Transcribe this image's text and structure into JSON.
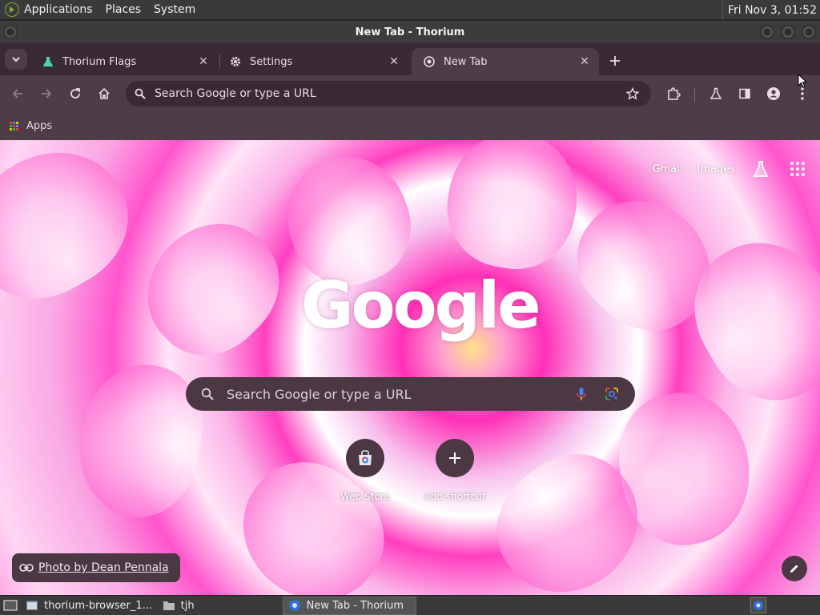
{
  "top_panel": {
    "menus": [
      "Applications",
      "Places",
      "System"
    ],
    "clock": "Fri Nov  3, 01:52"
  },
  "window": {
    "title": "New Tab - Thorium"
  },
  "tabs": [
    {
      "label": "Thorium Flags",
      "icon": "flask-icon",
      "active": false
    },
    {
      "label": "Settings",
      "icon": "gear-icon",
      "active": false
    },
    {
      "label": "New Tab",
      "icon": "chrome-icon",
      "active": true
    }
  ],
  "toolbar": {
    "omnibox_placeholder": "Search Google or type a URL"
  },
  "bookmarks": {
    "apps_label": "Apps"
  },
  "ntp": {
    "top_links": [
      "Gmail",
      "Images"
    ],
    "logo_text": "Google",
    "search_placeholder": "Search Google or type a URL",
    "shortcuts": [
      {
        "label": "Web Store",
        "icon": "web-store-icon"
      },
      {
        "label": "Add shortcut",
        "icon": "plus-icon"
      }
    ],
    "attribution": "Photo by Dean Pennala"
  },
  "taskbar": {
    "items": [
      {
        "label": "thorium-browser_1…",
        "icon": "terminal-icon"
      },
      {
        "label": "tjh",
        "icon": "folder-icon"
      },
      {
        "label": "New Tab - Thorium",
        "icon": "thorium-icon",
        "active": true
      }
    ]
  },
  "colors": {
    "tabstrip": "#3a2a34",
    "toolbar": "#4e3c47",
    "panel": "#3a3a3a"
  }
}
